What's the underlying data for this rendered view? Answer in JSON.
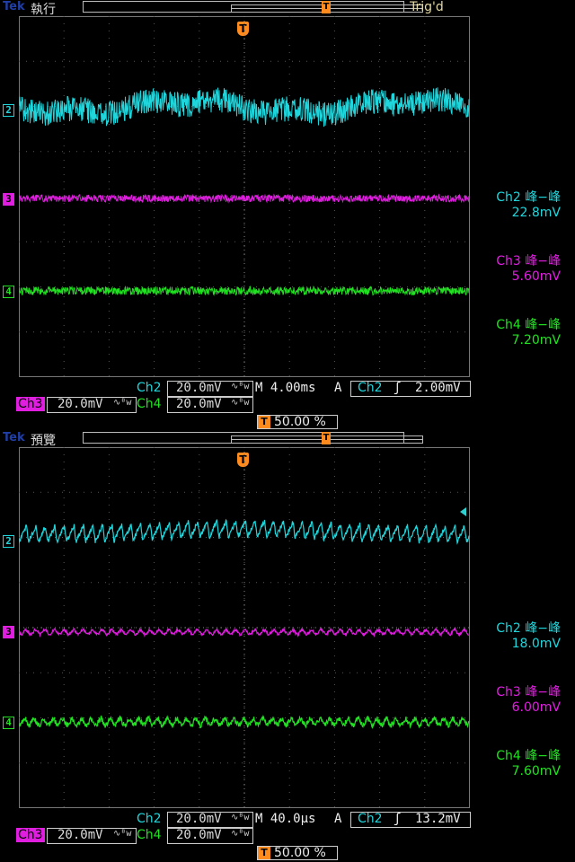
{
  "colors": {
    "ch2": "#1fd6dc",
    "ch3": "#e01ee0",
    "ch4": "#22e022",
    "trigger": "#ff8a1e",
    "tek": "#1f3ea8"
  },
  "scopes": [
    {
      "brand": "Tek",
      "status": "執行",
      "trig_state": "Trig'd",
      "markers": [
        "2",
        "3",
        "4"
      ],
      "meas": [
        {
          "label": "Ch2 峰−峰",
          "value": "22.8mV"
        },
        {
          "label": "Ch3 峰−峰",
          "value": "5.60mV"
        },
        {
          "label": "Ch4 峰−峰",
          "value": "7.20mV"
        }
      ],
      "bottom": {
        "ch2_label": "Ch2",
        "ch2_scale": "20.0mV",
        "ch3_label": "Ch3",
        "ch3_scale": "20.0mV",
        "ch4_label": "Ch4",
        "ch4_scale": "20.0mV",
        "timebase": "M 4.00ms",
        "trig_mode": "A",
        "trig_src": "Ch2",
        "trig_level": "2.00mV",
        "trig_pos": "50.00 %"
      }
    },
    {
      "brand": "Tek",
      "status": "預覽",
      "trig_state": "",
      "markers": [
        "2",
        "3",
        "4"
      ],
      "meas": [
        {
          "label": "Ch2 峰−峰",
          "value": "18.0mV"
        },
        {
          "label": "Ch3 峰−峰",
          "value": "6.00mV"
        },
        {
          "label": "Ch4 峰−峰",
          "value": "7.60mV"
        }
      ],
      "bottom": {
        "ch2_label": "Ch2",
        "ch2_scale": "20.0mV",
        "ch3_label": "Ch3",
        "ch3_scale": "20.0mV",
        "ch4_label": "Ch4",
        "ch4_scale": "20.0mV",
        "timebase": "M 40.0µs",
        "trig_mode": "A",
        "trig_src": "Ch2",
        "trig_level": "13.2mV",
        "trig_pos": "50.00 %"
      }
    }
  ],
  "icons": {
    "trigger": "T-trigger-icon",
    "bandwidth": "bw-limit-icon",
    "edge": "rising-edge-icon"
  }
}
